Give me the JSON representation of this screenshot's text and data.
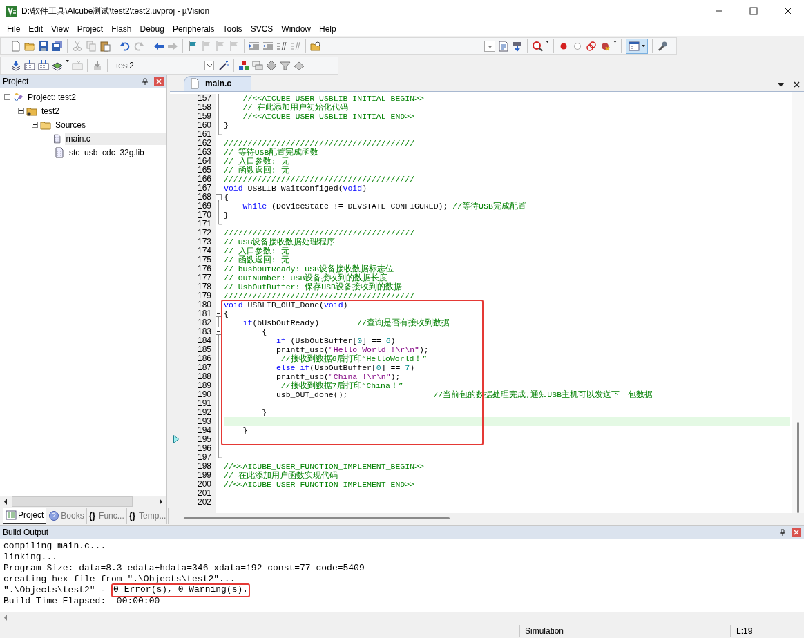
{
  "window": {
    "title": "D:\\软件工具\\Alcube测试\\test2\\test2.uvproj - µVision"
  },
  "menu": [
    "File",
    "Edit",
    "View",
    "Project",
    "Flash",
    "Debug",
    "Peripherals",
    "Tools",
    "SVCS",
    "Window",
    "Help"
  ],
  "target_select": {
    "value": "test2"
  },
  "project_panel": {
    "title": "Project",
    "tree": [
      {
        "label": "Project: test2",
        "kind": "project",
        "expanded": true,
        "selected": false,
        "children": [
          {
            "label": "test2",
            "kind": "target",
            "expanded": true,
            "selected": false,
            "children": [
              {
                "label": "Sources",
                "kind": "folder",
                "expanded": true,
                "selected": false,
                "children": [
                  {
                    "label": "main.c",
                    "kind": "file",
                    "selected": true
                  },
                  {
                    "label": "stc_usb_cdc_32g.lib",
                    "kind": "file",
                    "selected": false
                  }
                ]
              }
            ]
          }
        ]
      }
    ],
    "tabs": [
      {
        "label": "Project",
        "kind": "project",
        "selected": true
      },
      {
        "label": "Books",
        "kind": "books",
        "selected": false
      },
      {
        "label": "Func...",
        "glyph": "{}",
        "kind": "functions",
        "selected": false
      },
      {
        "label": "Temp...",
        "glyph": "{}",
        "kind": "templates",
        "selected": false
      }
    ]
  },
  "editor": {
    "tabs": [
      {
        "label": "main.c",
        "selected": true
      }
    ],
    "blocks": [
      {
        "boxed": false,
        "lines": [
          {
            "n": "157",
            "kind": "foldbody",
            "code": [
              {
                "kind": "comment",
                "text": "    //<<AICUBE_USER_USBLIB_INITIAL_BEGIN>>"
              }
            ]
          },
          {
            "n": "158",
            "kind": "foldbody",
            "code": [
              {
                "kind": "comment",
                "text": "    // 在此添加用户初始化代码"
              }
            ]
          },
          {
            "n": "159",
            "kind": "foldbody",
            "code": [
              {
                "kind": "comment",
                "text": "    //<<AICUBE_USER_USBLIB_INITIAL_END>>"
              }
            ]
          },
          {
            "n": "160",
            "kind": "foldbody",
            "code": [
              {
                "kind": "plain",
                "text": "}"
              }
            ]
          },
          {
            "n": "161",
            "kind": "foldend"
          },
          {
            "n": "162",
            "kind": "plain",
            "code": [
              {
                "kind": "comment",
                "text": "////////////////////////////////////////"
              }
            ]
          },
          {
            "n": "163",
            "kind": "plain",
            "code": [
              {
                "kind": "comment",
                "text": "// 等待USB配置完成函数"
              }
            ]
          },
          {
            "n": "164",
            "kind": "plain",
            "code": [
              {
                "kind": "comment",
                "text": "// 入口参数: 无"
              }
            ]
          },
          {
            "n": "165",
            "kind": "plain",
            "code": [
              {
                "kind": "comment",
                "text": "// 函数返回: 无"
              }
            ]
          },
          {
            "n": "166",
            "kind": "plain",
            "code": [
              {
                "kind": "comment",
                "text": "////////////////////////////////////////"
              }
            ]
          },
          {
            "n": "167",
            "kind": "plain",
            "code": [
              {
                "kind": "keyword",
                "text": "void"
              },
              {
                "kind": "plain",
                "text": " USBLIB_WaitConfiged("
              },
              {
                "kind": "keyword",
                "text": "void"
              },
              {
                "kind": "plain",
                "text": ")"
              }
            ]
          },
          {
            "n": "168",
            "kind": "foldstart",
            "code": [
              {
                "kind": "plain",
                "text": "{"
              }
            ]
          },
          {
            "n": "169",
            "kind": "foldbody",
            "code": [
              {
                "kind": "keyword",
                "text": "    while"
              },
              {
                "kind": "plain",
                "text": " (DeviceState != DEVSTATE_CONFIGURED); "
              },
              {
                "kind": "comment",
                "text": "//等待USB完成配置"
              }
            ]
          },
          {
            "n": "170",
            "kind": "foldbody",
            "code": [
              {
                "kind": "plain",
                "text": "}"
              }
            ]
          },
          {
            "n": "171",
            "kind": "foldend"
          },
          {
            "n": "172",
            "kind": "plain",
            "code": [
              {
                "kind": "comment",
                "text": "////////////////////////////////////////"
              }
            ]
          },
          {
            "n": "173",
            "kind": "plain",
            "code": [
              {
                "kind": "comment",
                "text": "// USB设备接收数据处理程序"
              }
            ]
          },
          {
            "n": "174",
            "kind": "plain",
            "code": [
              {
                "kind": "comment",
                "text": "// 入口参数: 无"
              }
            ]
          },
          {
            "n": "175",
            "kind": "plain",
            "code": [
              {
                "kind": "comment",
                "text": "// 函数返回: 无"
              }
            ]
          },
          {
            "n": "176",
            "kind": "plain",
            "code": [
              {
                "kind": "comment",
                "text": "// bUsbOutReady: USB设备接收数据标志位"
              }
            ]
          },
          {
            "n": "177",
            "kind": "plain",
            "code": [
              {
                "kind": "comment",
                "text": "// OutNumber: USB设备接收到的数据长度"
              }
            ]
          },
          {
            "n": "178",
            "kind": "plain",
            "code": [
              {
                "kind": "comment",
                "text": "// UsbOutBuffer: 保存USB设备接收到的数据"
              }
            ]
          },
          {
            "n": "179",
            "kind": "plain",
            "code": [
              {
                "kind": "comment",
                "text": "////////////////////////////////////////"
              }
            ]
          }
        ]
      },
      {
        "boxed": true,
        "lines": [
          {
            "n": "180",
            "kind": "plain",
            "code": [
              {
                "kind": "keyword",
                "text": "void"
              },
              {
                "kind": "plain",
                "text": " USBLIB_OUT_Done("
              },
              {
                "kind": "keyword",
                "text": "void"
              },
              {
                "kind": "plain",
                "text": ")"
              }
            ]
          },
          {
            "n": "181",
            "kind": "foldstart",
            "code": [
              {
                "kind": "plain",
                "text": "{"
              }
            ]
          },
          {
            "n": "182",
            "kind": "foldbody",
            "code": [
              {
                "kind": "keyword",
                "text": "    if"
              },
              {
                "kind": "plain",
                "text": "(bUsbOutReady)        "
              },
              {
                "kind": "comment",
                "text": "//查询是否有接收到数据"
              }
            ]
          },
          {
            "n": "183",
            "kind": "foldstart",
            "code": [
              {
                "kind": "plain",
                "text": "        {"
              }
            ]
          },
          {
            "n": "184",
            "kind": "foldbody",
            "code": [
              {
                "kind": "keyword",
                "text": "           if"
              },
              {
                "kind": "plain",
                "text": " (UsbOutBuffer["
              },
              {
                "kind": "number",
                "text": "0"
              },
              {
                "kind": "plain",
                "text": "] == "
              },
              {
                "kind": "number",
                "text": "6"
              },
              {
                "kind": "plain",
                "text": ")"
              }
            ]
          },
          {
            "n": "185",
            "kind": "foldbody",
            "code": [
              {
                "kind": "plain",
                "text": "           printf_usb("
              },
              {
                "kind": "string",
                "text": "\"Hello World !\\r\\n\""
              },
              {
                "kind": "plain",
                "text": ");"
              }
            ]
          },
          {
            "n": "186",
            "kind": "foldbody",
            "code": [
              {
                "kind": "comment",
                "text": "            //接收到数据6后打印“HelloWorld！”"
              }
            ]
          },
          {
            "n": "187",
            "kind": "foldbody",
            "code": [
              {
                "kind": "keyword",
                "text": "           else if"
              },
              {
                "kind": "plain",
                "text": "(UsbOutBuffer["
              },
              {
                "kind": "number",
                "text": "0"
              },
              {
                "kind": "plain",
                "text": "] == "
              },
              {
                "kind": "number",
                "text": "7"
              },
              {
                "kind": "plain",
                "text": ")"
              }
            ]
          },
          {
            "n": "188",
            "kind": "foldbody",
            "code": [
              {
                "kind": "plain",
                "text": "           printf_usb("
              },
              {
                "kind": "string",
                "text": "\"China !\\r\\n\""
              },
              {
                "kind": "plain",
                "text": ");"
              }
            ]
          },
          {
            "n": "189",
            "kind": "foldbody",
            "code": [
              {
                "kind": "comment",
                "text": "            //接收到数据7后打印“China！”"
              }
            ]
          },
          {
            "n": "190",
            "kind": "foldbody",
            "code": [
              {
                "kind": "plain",
                "text": "           usb_OUT_done();                  "
              },
              {
                "kind": "comment",
                "text": "//当前包的数据处理完成,通知USB主机可以发送下一包数据"
              }
            ]
          },
          {
            "n": "191",
            "kind": "foldbody"
          },
          {
            "n": "192",
            "kind": "foldbody",
            "code": [
              {
                "kind": "plain",
                "text": "        }"
              }
            ]
          },
          {
            "n": "193",
            "kind": "foldbody",
            "highlighted": true
          },
          {
            "n": "194",
            "kind": "foldbody",
            "code": [
              {
                "kind": "plain",
                "text": "    }"
              }
            ]
          },
          {
            "n": "195",
            "kind": "foldbody",
            "current": true
          }
        ]
      },
      {
        "boxed": false,
        "lines": [
          {
            "n": "196",
            "kind": "foldbody"
          },
          {
            "n": "197",
            "kind": "foldend"
          },
          {
            "n": "198",
            "kind": "plain",
            "code": [
              {
                "kind": "comment",
                "text": "//<<AICUBE_USER_FUNCTION_IMPLEMENT_BEGIN>>"
              }
            ]
          },
          {
            "n": "199",
            "kind": "plain",
            "code": [
              {
                "kind": "comment",
                "text": "// 在此添加用户函数实现代码"
              }
            ]
          },
          {
            "n": "200",
            "kind": "plain",
            "code": [
              {
                "kind": "comment",
                "text": "//<<AICUBE_USER_FUNCTION_IMPLEMENT_END>>"
              }
            ]
          },
          {
            "n": "201",
            "kind": "plain"
          },
          {
            "n": "202",
            "kind": "plain"
          }
        ]
      }
    ]
  },
  "build_output": {
    "title": "Build Output",
    "lines": [
      [
        {
          "text": "compiling main.c..."
        }
      ],
      [
        {
          "text": "linking..."
        }
      ],
      [
        {
          "text": "Program Size: data=8.3 edata+hdata=346 xdata=192 const=77 code=5409"
        }
      ],
      [
        {
          "text": "creating hex file from \".\\Objects\\test2\"..."
        }
      ],
      [
        {
          "text": "\".\\Objects\\test2\" - "
        },
        {
          "text": "0 Error(s), 0 Warning(s).",
          "boxed": true
        }
      ],
      [
        {
          "text": "Build Time Elapsed:  00:00:00"
        }
      ]
    ]
  },
  "status_bar": {
    "mode": "Simulation",
    "position": "L:19"
  }
}
